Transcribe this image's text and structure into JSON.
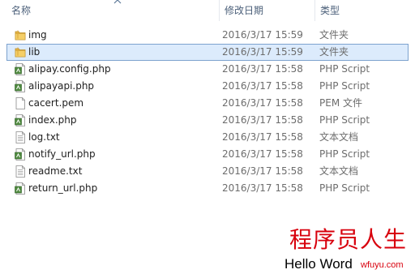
{
  "columns": {
    "name": "名称",
    "date": "修改日期",
    "type": "类型"
  },
  "files": [
    {
      "name": "img",
      "date": "2016/3/17 15:59",
      "type": "文件夹",
      "icon": "folder-icon",
      "selected": false
    },
    {
      "name": "lib",
      "date": "2016/3/17 15:59",
      "type": "文件夹",
      "icon": "folder-icon",
      "selected": true
    },
    {
      "name": "alipay.config.php",
      "date": "2016/3/17 15:58",
      "type": "PHP Script",
      "icon": "php-file-icon",
      "selected": false
    },
    {
      "name": "alipayapi.php",
      "date": "2016/3/17 15:58",
      "type": "PHP Script",
      "icon": "php-file-icon",
      "selected": false
    },
    {
      "name": "cacert.pem",
      "date": "2016/3/17 15:58",
      "type": "PEM 文件",
      "icon": "blank-file-icon",
      "selected": false
    },
    {
      "name": "index.php",
      "date": "2016/3/17 15:58",
      "type": "PHP Script",
      "icon": "php-file-icon",
      "selected": false
    },
    {
      "name": "log.txt",
      "date": "2016/3/17 15:58",
      "type": "文本文档",
      "icon": "text-file-icon",
      "selected": false
    },
    {
      "name": "notify_url.php",
      "date": "2016/3/17 15:58",
      "type": "PHP Script",
      "icon": "php-file-icon",
      "selected": false
    },
    {
      "name": "readme.txt",
      "date": "2016/3/17 15:58",
      "type": "文本文档",
      "icon": "text-file-icon",
      "selected": false
    },
    {
      "name": "return_url.php",
      "date": "2016/3/17 15:58",
      "type": "PHP Script",
      "icon": "php-file-icon",
      "selected": false
    }
  ],
  "watermark": {
    "title": "程序员人生",
    "subtitle": "Hello Word",
    "site": "wfuyu.com"
  },
  "colors": {
    "selection": "#dcebfc",
    "selection_border": "#7da2ce",
    "header_text": "#4c607a",
    "folder": "#e8b84a",
    "watermark_red": "#d8000d"
  }
}
